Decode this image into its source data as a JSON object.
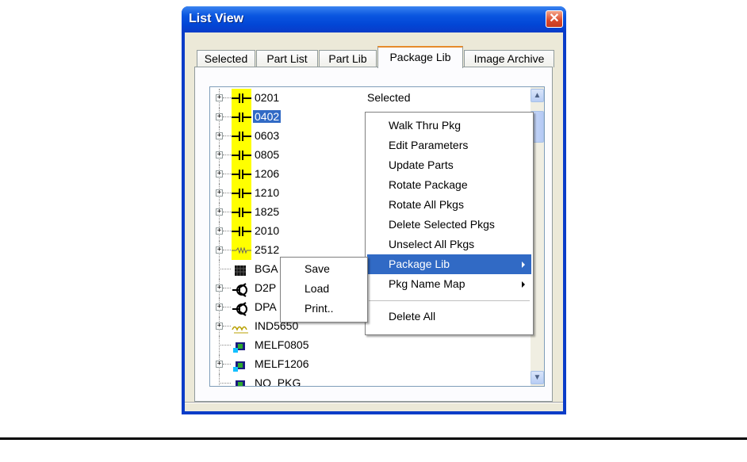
{
  "window": {
    "title": "List View",
    "close_symbol": "✕"
  },
  "tabs": [
    {
      "label": "Selected"
    },
    {
      "label": "Part List"
    },
    {
      "label": "Part Lib"
    },
    {
      "label": "Package Lib"
    },
    {
      "label": "Image Archive"
    }
  ],
  "tree": {
    "status_text": "Selected",
    "rows": [
      {
        "label": "0201",
        "expander": "+",
        "icon": "capacitor-icon",
        "selected": false
      },
      {
        "label": "0402",
        "expander": "+",
        "icon": "capacitor-icon",
        "selected": true
      },
      {
        "label": "0603",
        "expander": "+",
        "icon": "capacitor-icon",
        "selected": false
      },
      {
        "label": "0805",
        "expander": "+",
        "icon": "capacitor-icon",
        "selected": false
      },
      {
        "label": "1206",
        "expander": "+",
        "icon": "capacitor-icon",
        "selected": false
      },
      {
        "label": "1210",
        "expander": "+",
        "icon": "capacitor-icon",
        "selected": false
      },
      {
        "label": "1825",
        "expander": "+",
        "icon": "capacitor-icon",
        "selected": false
      },
      {
        "label": "2010",
        "expander": "+",
        "icon": "capacitor-icon",
        "selected": false
      },
      {
        "label": "2512",
        "expander": "+",
        "icon": "resistor-icon",
        "selected": false
      },
      {
        "label": "BGA",
        "expander": "",
        "icon": "bga-chip-icon",
        "selected": false
      },
      {
        "label": "D2P",
        "expander": "+",
        "icon": "transistor-icon",
        "selected": false
      },
      {
        "label": "DPA",
        "expander": "+",
        "icon": "transistor-icon",
        "selected": false
      },
      {
        "label": "IND5650",
        "expander": "+",
        "icon": "inductor-icon",
        "selected": false
      },
      {
        "label": "MELF0805",
        "expander": "",
        "icon": "melf-icon",
        "selected": false
      },
      {
        "label": "MELF1206",
        "expander": "+",
        "icon": "melf-icon",
        "selected": false
      },
      {
        "label": "NO_PKG",
        "expander": "",
        "icon": "melf-icon",
        "selected": false
      }
    ]
  },
  "context_menu": {
    "items": [
      {
        "label": "Walk Thru Pkg"
      },
      {
        "label": "Edit Parameters"
      },
      {
        "label": "Update Parts"
      },
      {
        "label": "Rotate Package"
      },
      {
        "label": "Rotate All Pkgs"
      },
      {
        "label": "Delete Selected Pkgs"
      },
      {
        "label": "Unselect All Pkgs"
      },
      {
        "label": "Package Lib",
        "submenu": true,
        "highlighted": true
      },
      {
        "label": "Pkg Name Map",
        "submenu": true
      },
      {
        "label": "Delete All"
      }
    ]
  },
  "sub_menu": {
    "items": [
      {
        "label": "Save"
      },
      {
        "label": "Load"
      },
      {
        "label": "Print.."
      }
    ]
  },
  "scrollbar": {
    "up_symbol": "▲",
    "down_symbol": "▼"
  },
  "colors": {
    "selection": "#316ac5",
    "titlebar": "#0a56e0",
    "tab_highlight": "#e68b2c",
    "icon_bg": "#ffff00"
  }
}
